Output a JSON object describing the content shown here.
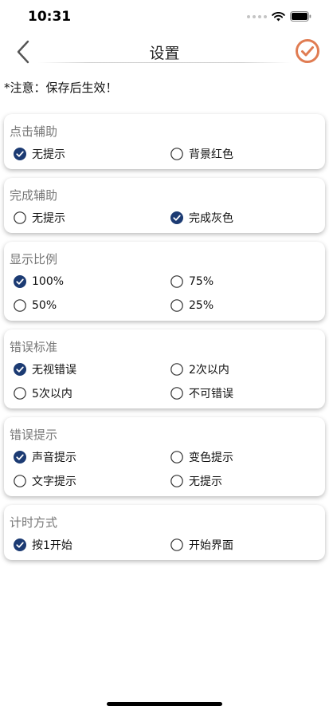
{
  "status_bar": {
    "time": "10:31"
  },
  "nav": {
    "title": "设置"
  },
  "notice": "*注意：保存后生效！",
  "sections": [
    {
      "title": "点击辅助",
      "options": [
        {
          "label": "无提示",
          "selected": true
        },
        {
          "label": "背景红色",
          "selected": false
        }
      ]
    },
    {
      "title": "完成辅助",
      "options": [
        {
          "label": "无提示",
          "selected": false
        },
        {
          "label": "完成灰色",
          "selected": true
        }
      ]
    },
    {
      "title": "显示比例",
      "options": [
        {
          "label": "100%",
          "selected": true
        },
        {
          "label": "75%",
          "selected": false
        },
        {
          "label": "50%",
          "selected": false
        },
        {
          "label": "25%",
          "selected": false
        }
      ]
    },
    {
      "title": "错误标准",
      "options": [
        {
          "label": "无视错误",
          "selected": true
        },
        {
          "label": "2次以内",
          "selected": false
        },
        {
          "label": "5次以内",
          "selected": false
        },
        {
          "label": "不可错误",
          "selected": false
        }
      ]
    },
    {
      "title": "错误提示",
      "options": [
        {
          "label": "声音提示",
          "selected": true
        },
        {
          "label": "变色提示",
          "selected": false
        },
        {
          "label": "文字提示",
          "selected": false
        },
        {
          "label": "无提示",
          "selected": false
        }
      ]
    },
    {
      "title": "计时方式",
      "options": [
        {
          "label": "按1开始",
          "selected": true
        },
        {
          "label": "开始界面",
          "selected": false
        }
      ]
    }
  ],
  "colors": {
    "accent_confirm": "#e07c52",
    "radio_selected": "#1c3b73",
    "back_arrow": "#555555"
  },
  "icons": {
    "back": "chevron-left-icon",
    "confirm": "check-circle-icon",
    "radio_on": "radio-checked-icon",
    "radio_off": "radio-empty-icon"
  }
}
